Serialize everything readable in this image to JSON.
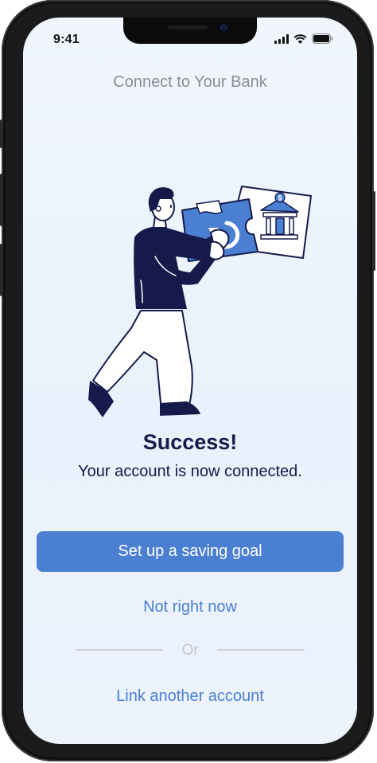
{
  "status_bar": {
    "time": "9:41",
    "icons": [
      "cellular-signal-icon",
      "wifi-icon",
      "battery-icon"
    ]
  },
  "header": {
    "title": "Connect to Your Bank"
  },
  "illustration": {
    "name": "person-connecting-bank-puzzle-illustration",
    "icons": [
      "refresh-icon",
      "bank-building-icon",
      "dollar-icon"
    ]
  },
  "message": {
    "title": "Success!",
    "subtitle": "Your account is now connected."
  },
  "actions": {
    "primary_label": "Set up a saving goal",
    "secondary_label": "Not right now",
    "divider_label": "Or",
    "tertiary_label": "Link another account"
  },
  "colors": {
    "accent": "#4a7fd2",
    "navy": "#161a4a",
    "muted_text": "#8a8d93",
    "background": "#eef4fd",
    "divider": "#cdd2da"
  }
}
